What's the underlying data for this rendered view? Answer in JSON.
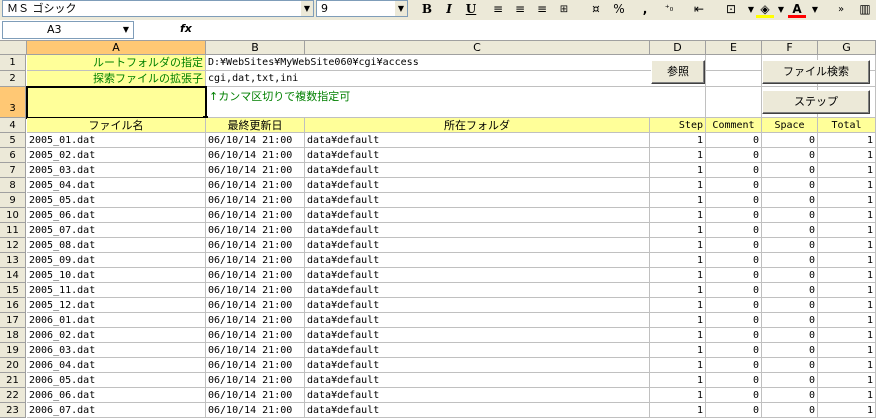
{
  "toolbar": {
    "font_name": "ＭＳ ゴシック",
    "font_size": "9",
    "bold": "B",
    "italic": "I",
    "underline": "U",
    "percent": "%",
    "comma": ",",
    "font_color_letter": "A"
  },
  "formula_bar": {
    "name_box": "A3",
    "fx": "fx",
    "content": ""
  },
  "columns": [
    "A",
    "B",
    "C",
    "D",
    "E",
    "F",
    "G"
  ],
  "rows_header": {
    "r1_label": "ルートフォルダの指定",
    "r1_value": "D:¥WebSites¥MyWebSite060¥cgi¥access",
    "r2_label": "探索ファイルの拡張子",
    "r2_value": "cgi,dat,txt,ini",
    "r3_note": "↑カンマ区切りで複数指定可"
  },
  "buttons": {
    "browse": "参照",
    "file_search": "ファイル検索",
    "step": "ステップ"
  },
  "table_headers": [
    "ファイル名",
    "最終更新日",
    "所在フォルダ",
    "Step",
    "Comment",
    "Space",
    "Total"
  ],
  "table_rows": [
    [
      "2005_01.dat",
      "06/10/14 21:00",
      "data¥default",
      "1",
      "0",
      "0",
      "1"
    ],
    [
      "2005_02.dat",
      "06/10/14 21:00",
      "data¥default",
      "1",
      "0",
      "0",
      "1"
    ],
    [
      "2005_03.dat",
      "06/10/14 21:00",
      "data¥default",
      "1",
      "0",
      "0",
      "1"
    ],
    [
      "2005_04.dat",
      "06/10/14 21:00",
      "data¥default",
      "1",
      "0",
      "0",
      "1"
    ],
    [
      "2005_05.dat",
      "06/10/14 21:00",
      "data¥default",
      "1",
      "0",
      "0",
      "1"
    ],
    [
      "2005_06.dat",
      "06/10/14 21:00",
      "data¥default",
      "1",
      "0",
      "0",
      "1"
    ],
    [
      "2005_07.dat",
      "06/10/14 21:00",
      "data¥default",
      "1",
      "0",
      "0",
      "1"
    ],
    [
      "2005_08.dat",
      "06/10/14 21:00",
      "data¥default",
      "1",
      "0",
      "0",
      "1"
    ],
    [
      "2005_09.dat",
      "06/10/14 21:00",
      "data¥default",
      "1",
      "0",
      "0",
      "1"
    ],
    [
      "2005_10.dat",
      "06/10/14 21:00",
      "data¥default",
      "1",
      "0",
      "0",
      "1"
    ],
    [
      "2005_11.dat",
      "06/10/14 21:00",
      "data¥default",
      "1",
      "0",
      "0",
      "1"
    ],
    [
      "2005_12.dat",
      "06/10/14 21:00",
      "data¥default",
      "1",
      "0",
      "0",
      "1"
    ],
    [
      "2006_01.dat",
      "06/10/14 21:00",
      "data¥default",
      "1",
      "0",
      "0",
      "1"
    ],
    [
      "2006_02.dat",
      "06/10/14 21:00",
      "data¥default",
      "1",
      "0",
      "0",
      "1"
    ],
    [
      "2006_03.dat",
      "06/10/14 21:00",
      "data¥default",
      "1",
      "0",
      "0",
      "1"
    ],
    [
      "2006_04.dat",
      "06/10/14 21:00",
      "data¥default",
      "1",
      "0",
      "0",
      "1"
    ],
    [
      "2006_05.dat",
      "06/10/14 21:00",
      "data¥default",
      "1",
      "0",
      "0",
      "1"
    ],
    [
      "2006_06.dat",
      "06/10/14 21:00",
      "data¥default",
      "1",
      "0",
      "0",
      "1"
    ],
    [
      "2006_07.dat",
      "06/10/14 21:00",
      "data¥default",
      "1",
      "0",
      "0",
      "1"
    ]
  ]
}
